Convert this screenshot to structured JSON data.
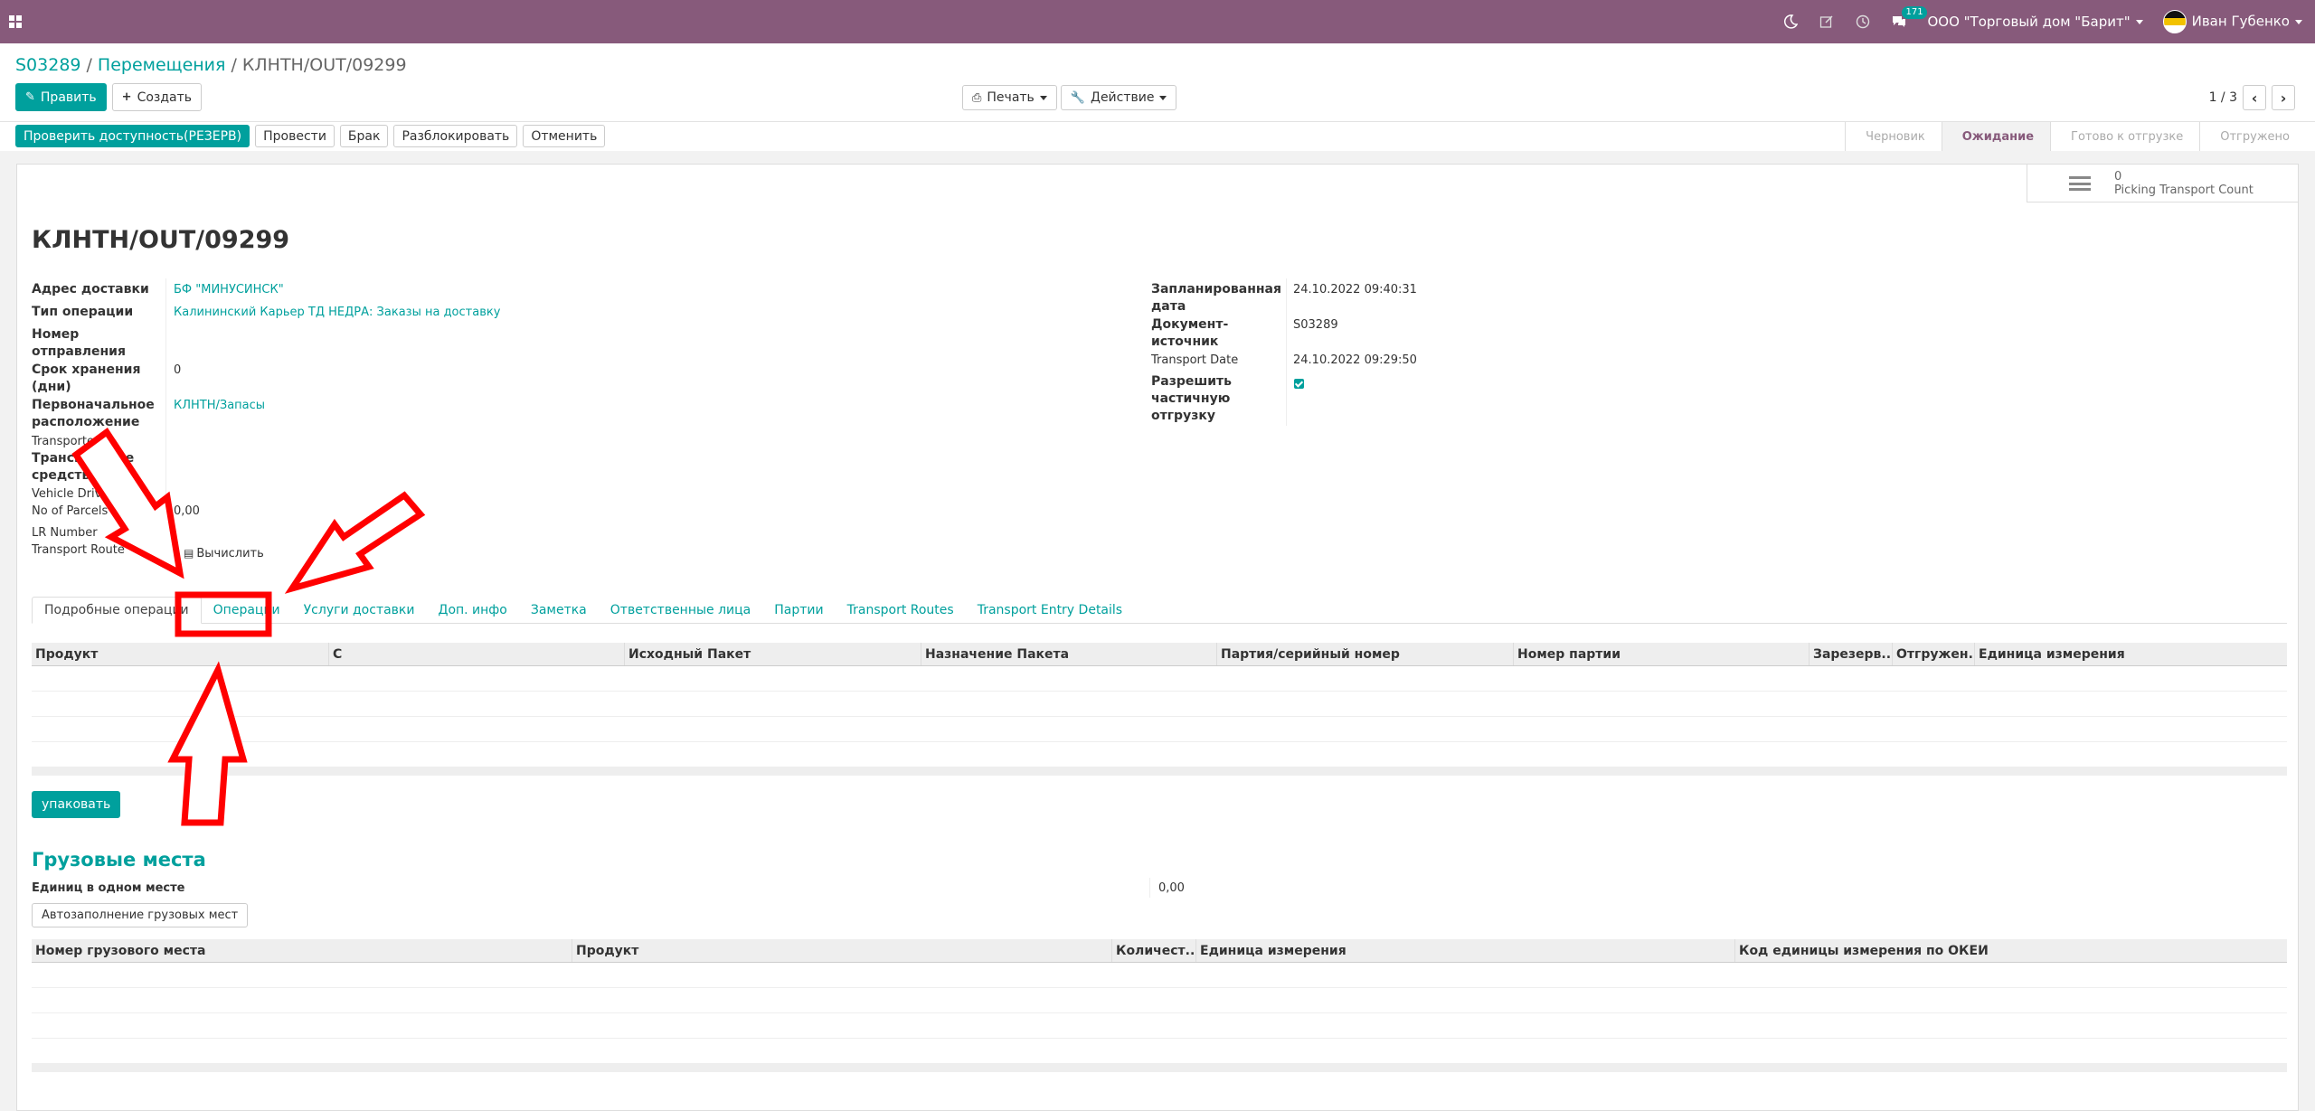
{
  "navbar": {
    "company": "ООО \"Торговый дом \"Барит\"",
    "user": "Иван Губенко",
    "messages_count": "171",
    "icons": [
      "apps-icon",
      "moon-icon",
      "edit-icon",
      "clock-icon",
      "chat-icon"
    ],
    "bg_color": "#875a7b"
  },
  "breadcrumb": {
    "items": [
      "S03289",
      "Перемещения"
    ],
    "current": "КЛНТН/OUT/09299"
  },
  "buttons": {
    "edit": "Править",
    "create": "Создать",
    "print": "Печать",
    "action": "Действие"
  },
  "pager": {
    "value": "1 / 3"
  },
  "status_buttons": [
    "Проверить доступность(РЕЗЕРВ)",
    "Провести",
    "Брак",
    "Разблокировать",
    "Отменить"
  ],
  "stages": [
    {
      "label": "Черновик",
      "active": false
    },
    {
      "label": "Ожидание",
      "active": true
    },
    {
      "label": "Готово к отгрузке",
      "active": false
    },
    {
      "label": "Отгружено",
      "active": false
    }
  ],
  "smart_button": {
    "count": "0",
    "label": "Picking Transport Count"
  },
  "record": {
    "title": "КЛНТН/OUT/09299"
  },
  "left_fields": [
    {
      "label": "Адрес доставки",
      "value": "БФ \"МИНУСИНСК\""
    },
    {
      "label": "Тип операции",
      "value": "Калининский Карьер ТД НЕДРА: Заказы на доставку"
    },
    {
      "label": "Номер отправления",
      "value": ""
    },
    {
      "label": "Срок хранения (дни)",
      "value": "0"
    },
    {
      "label": "Первоначальное расположение",
      "value": "КЛНТН/Запасы"
    },
    {
      "label": "Transporter",
      "value": ""
    },
    {
      "label": "Транспортное средство",
      "value": ""
    },
    {
      "label": "Vehicle Driver",
      "value": ""
    },
    {
      "label": "No of Parcels",
      "value": "0,00"
    },
    {
      "label": "LR Number",
      "value": ""
    },
    {
      "label": "Transport Route",
      "value": "Вычислить"
    }
  ],
  "right_fields": [
    {
      "label": "Запланированная дата",
      "value": "24.10.2022 09:40:31"
    },
    {
      "label": "Документ-источник",
      "value": "S03289"
    },
    {
      "label": "Transport Date",
      "value": "24.10.2022 09:29:50"
    },
    {
      "label": "Разрешить частичную отгрузку",
      "value": ""
    }
  ],
  "tabs": [
    {
      "label": "Подробные операции",
      "active": true
    },
    {
      "label": "Операции",
      "active": false
    },
    {
      "label": "Услуги доставки",
      "active": false
    },
    {
      "label": "Доп. инфо",
      "active": false
    },
    {
      "label": "Заметка",
      "active": false
    },
    {
      "label": "Ответственные лица",
      "active": false
    },
    {
      "label": "Партии",
      "active": false
    },
    {
      "label": "Transport Routes",
      "active": false
    },
    {
      "label": "Transport Entry Details",
      "active": false
    }
  ],
  "operations_table": {
    "columns": [
      "Продукт",
      "С",
      "Исходный Пакет",
      "Назначение Пакета",
      "Партия/серийный номер",
      "Номер партии",
      "Зарезерв...",
      "Отгружен...",
      "Единица измерения"
    ]
  },
  "pack_button": "упаковать",
  "cargo": {
    "title": "Грузовые места",
    "units_label": "Единиц в одном месте",
    "units_value": "0,00",
    "autofill_button": "Автозаполнение грузовых мест",
    "columns": [
      "Номер грузового места",
      "Продукт",
      "Количест...",
      "Единица измерения",
      "Код единицы измерения по ОКЕИ"
    ]
  },
  "colors": {
    "accent": "#00a09d",
    "brand": "#875a7b",
    "annotation": "#ff0000"
  }
}
